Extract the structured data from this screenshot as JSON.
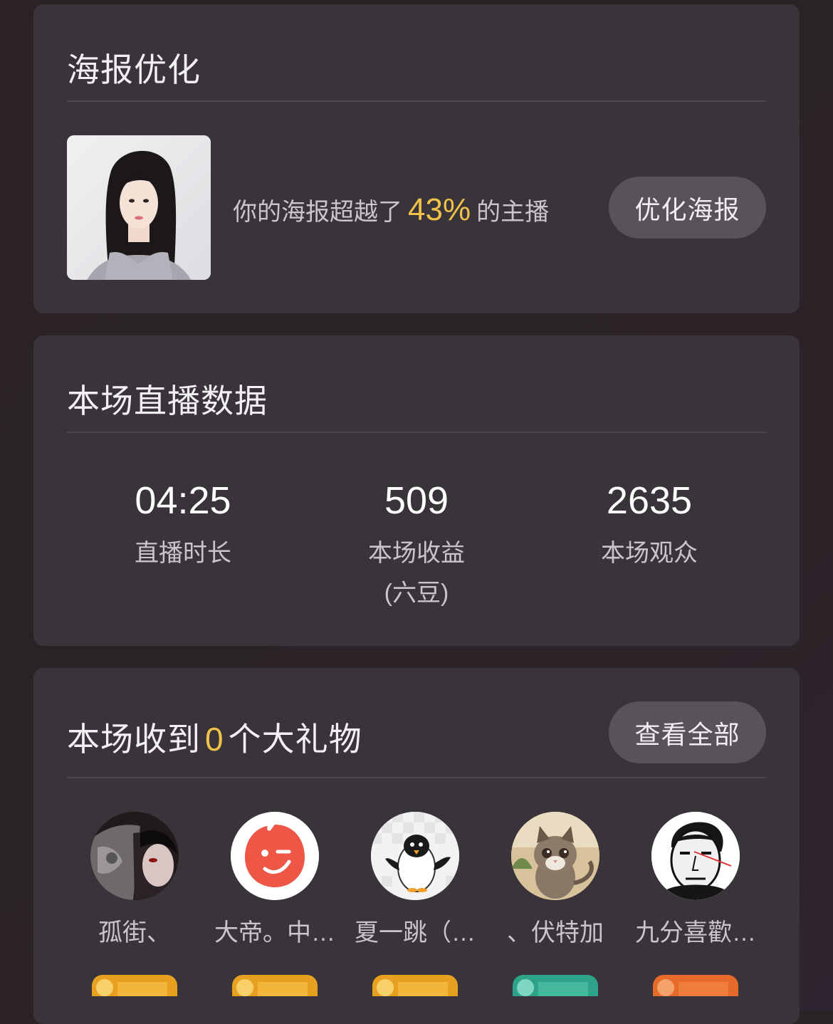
{
  "poster_card": {
    "title": "海报优化",
    "text_before": "你的海报超越了",
    "percent": "43%",
    "text_after": "的主播",
    "button_label": "优化海报"
  },
  "live_card": {
    "title": "本场直播数据",
    "stats": [
      {
        "value": "04:25",
        "label": "直播时长"
      },
      {
        "value": "509",
        "label": "本场收益(六豆)"
      },
      {
        "value": "2635",
        "label": "本场观众"
      }
    ]
  },
  "gifts_card": {
    "title_before": "本场收到",
    "count": "0",
    "title_after": "个大礼物",
    "button_label": "查看全部",
    "gifters": [
      {
        "name": "孤街、",
        "avatar": "dark-masked-avatar",
        "badge_color": "#e8a020"
      },
      {
        "name": "大帝。中…",
        "avatar": "red-smile-avatar",
        "badge_color": "#e8a020"
      },
      {
        "name": "夏一跳（…",
        "avatar": "penguin-avatar",
        "badge_color": "#e8a020"
      },
      {
        "name": "、伏特加",
        "avatar": "cat-avatar",
        "badge_color": "#2fa38a"
      },
      {
        "name": "九分喜歡…",
        "avatar": "man-face-avatar",
        "badge_color": "#e66a2a"
      }
    ]
  },
  "colors": {
    "background": "#2b2224",
    "card": "#38343a",
    "accent": "#f0c24a",
    "button": "#5a5259",
    "muted_text": "#c9c5ca"
  }
}
